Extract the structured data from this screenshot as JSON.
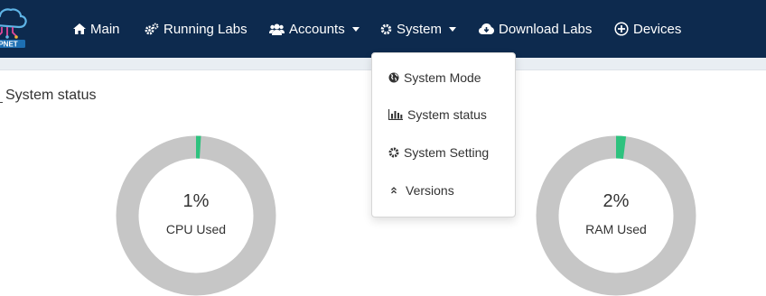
{
  "nav": {
    "logo_text": "PNET",
    "items": [
      {
        "label": "Main",
        "icon": "home-icon"
      },
      {
        "label": "Running Labs",
        "icon": "cogs-icon"
      },
      {
        "label": "Accounts",
        "icon": "users-icon",
        "has_dropdown": true
      },
      {
        "label": "System",
        "icon": "cog-icon",
        "has_dropdown": true
      },
      {
        "label": "Download Labs",
        "icon": "cloud-download-icon"
      },
      {
        "label": "Devices",
        "icon": "plus-circle-icon"
      }
    ]
  },
  "page": {
    "title": "System status"
  },
  "gauges": [
    {
      "value": "1%",
      "label": "CPU Used",
      "fraction": 0.01
    },
    {
      "value": "2%",
      "label": "RAM Used",
      "fraction": 0.02
    }
  ],
  "system_menu": {
    "items": [
      {
        "label": "System Mode",
        "icon": "globe-icon"
      },
      {
        "label": "System status",
        "icon": "bar-chart-icon"
      },
      {
        "label": "System Setting",
        "icon": "cog-icon"
      },
      {
        "label": "Versions",
        "icon": "angle-double-up-icon"
      }
    ]
  },
  "colors": {
    "navbar": "#0d2a4e",
    "gauge_track": "#c6c6c6",
    "gauge_fill": "#2ec27e"
  }
}
